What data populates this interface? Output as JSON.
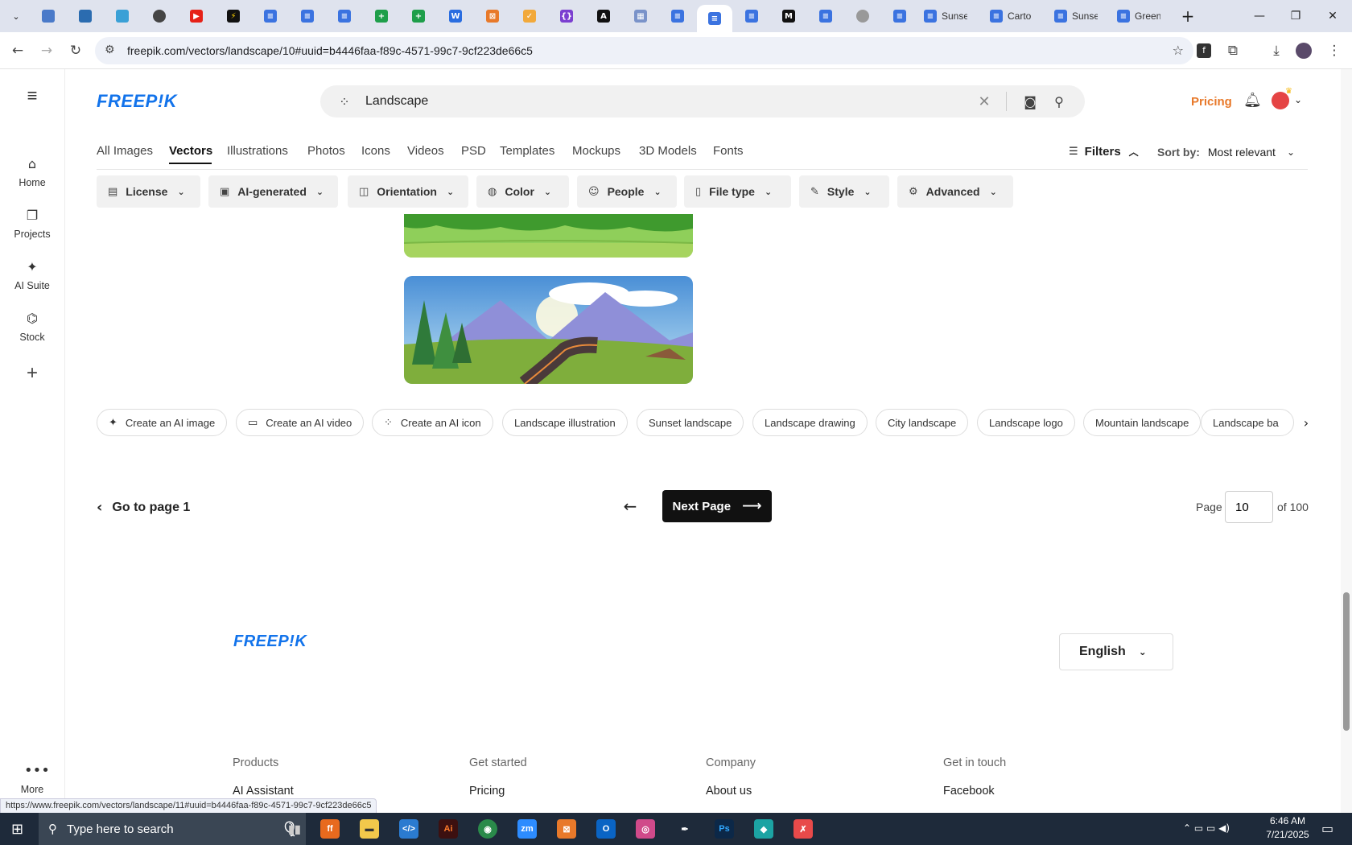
{
  "browser": {
    "tabs": [
      {
        "label": "Sunse",
        "color": "#1a73e8"
      },
      {
        "label": "Carto",
        "color": "#1a73e8"
      },
      {
        "label": "Sunse",
        "color": "#1a73e8"
      },
      {
        "label": "Green",
        "color": "#1a73e8"
      }
    ],
    "url": "freepik.com/vectors/landscape/10#uuid=b4446faa-f89c-4571-99c7-9cf223de66c5",
    "status_url": "https://www.freepik.com/vectors/landscape/11#uuid=b4446faa-f89c-4571-99c7-9cf223de66c5"
  },
  "rail": {
    "items": [
      {
        "label": "Home",
        "icon": "home-icon"
      },
      {
        "label": "Projects",
        "icon": "projects-icon"
      },
      {
        "label": "AI Suite",
        "icon": "sparkle-icon"
      },
      {
        "label": "Stock",
        "icon": "stock-icon"
      }
    ],
    "more_label": "More"
  },
  "header": {
    "logo": "FREEP!K",
    "search_value": "Landscape",
    "pricing": "Pricing"
  },
  "categories": [
    "All Images",
    "Vectors",
    "Illustrations",
    "Photos",
    "Icons",
    "Videos",
    "PSD",
    "Templates",
    "Mockups",
    "3D Models",
    "Fonts"
  ],
  "active_category": "Vectors",
  "filters_label": "Filters",
  "sort": {
    "label": "Sort by:",
    "value": "Most relevant"
  },
  "chips": [
    "License",
    "AI-generated",
    "Orientation",
    "Color",
    "People",
    "File type",
    "Style",
    "Advanced"
  ],
  "related": [
    "Create an AI image",
    "Create an AI video",
    "Create an AI icon",
    "Landscape illustration",
    "Sunset landscape",
    "Landscape drawing",
    "City landscape",
    "Landscape logo",
    "Mountain landscape",
    "Landscape ba"
  ],
  "pagination": {
    "goto_first": "Go to page 1",
    "next": "Next Page",
    "page_label": "Page",
    "current": "10",
    "of_total": "of 100"
  },
  "footer": {
    "logo": "FREEP!K",
    "language": "English",
    "columns": [
      {
        "title": "Products",
        "first": "AI Assistant"
      },
      {
        "title": "Get started",
        "first": "Pricing"
      },
      {
        "title": "Company",
        "first": "About us"
      },
      {
        "title": "Get in touch",
        "first": "Facebook"
      }
    ]
  },
  "taskbar": {
    "search_placeholder": "Type here to search",
    "time": "6:46 AM",
    "date": "7/21/2025"
  },
  "colors": {
    "accent": "#1273eb",
    "pricing": "#e8792a",
    "dark_button": "#111111"
  }
}
